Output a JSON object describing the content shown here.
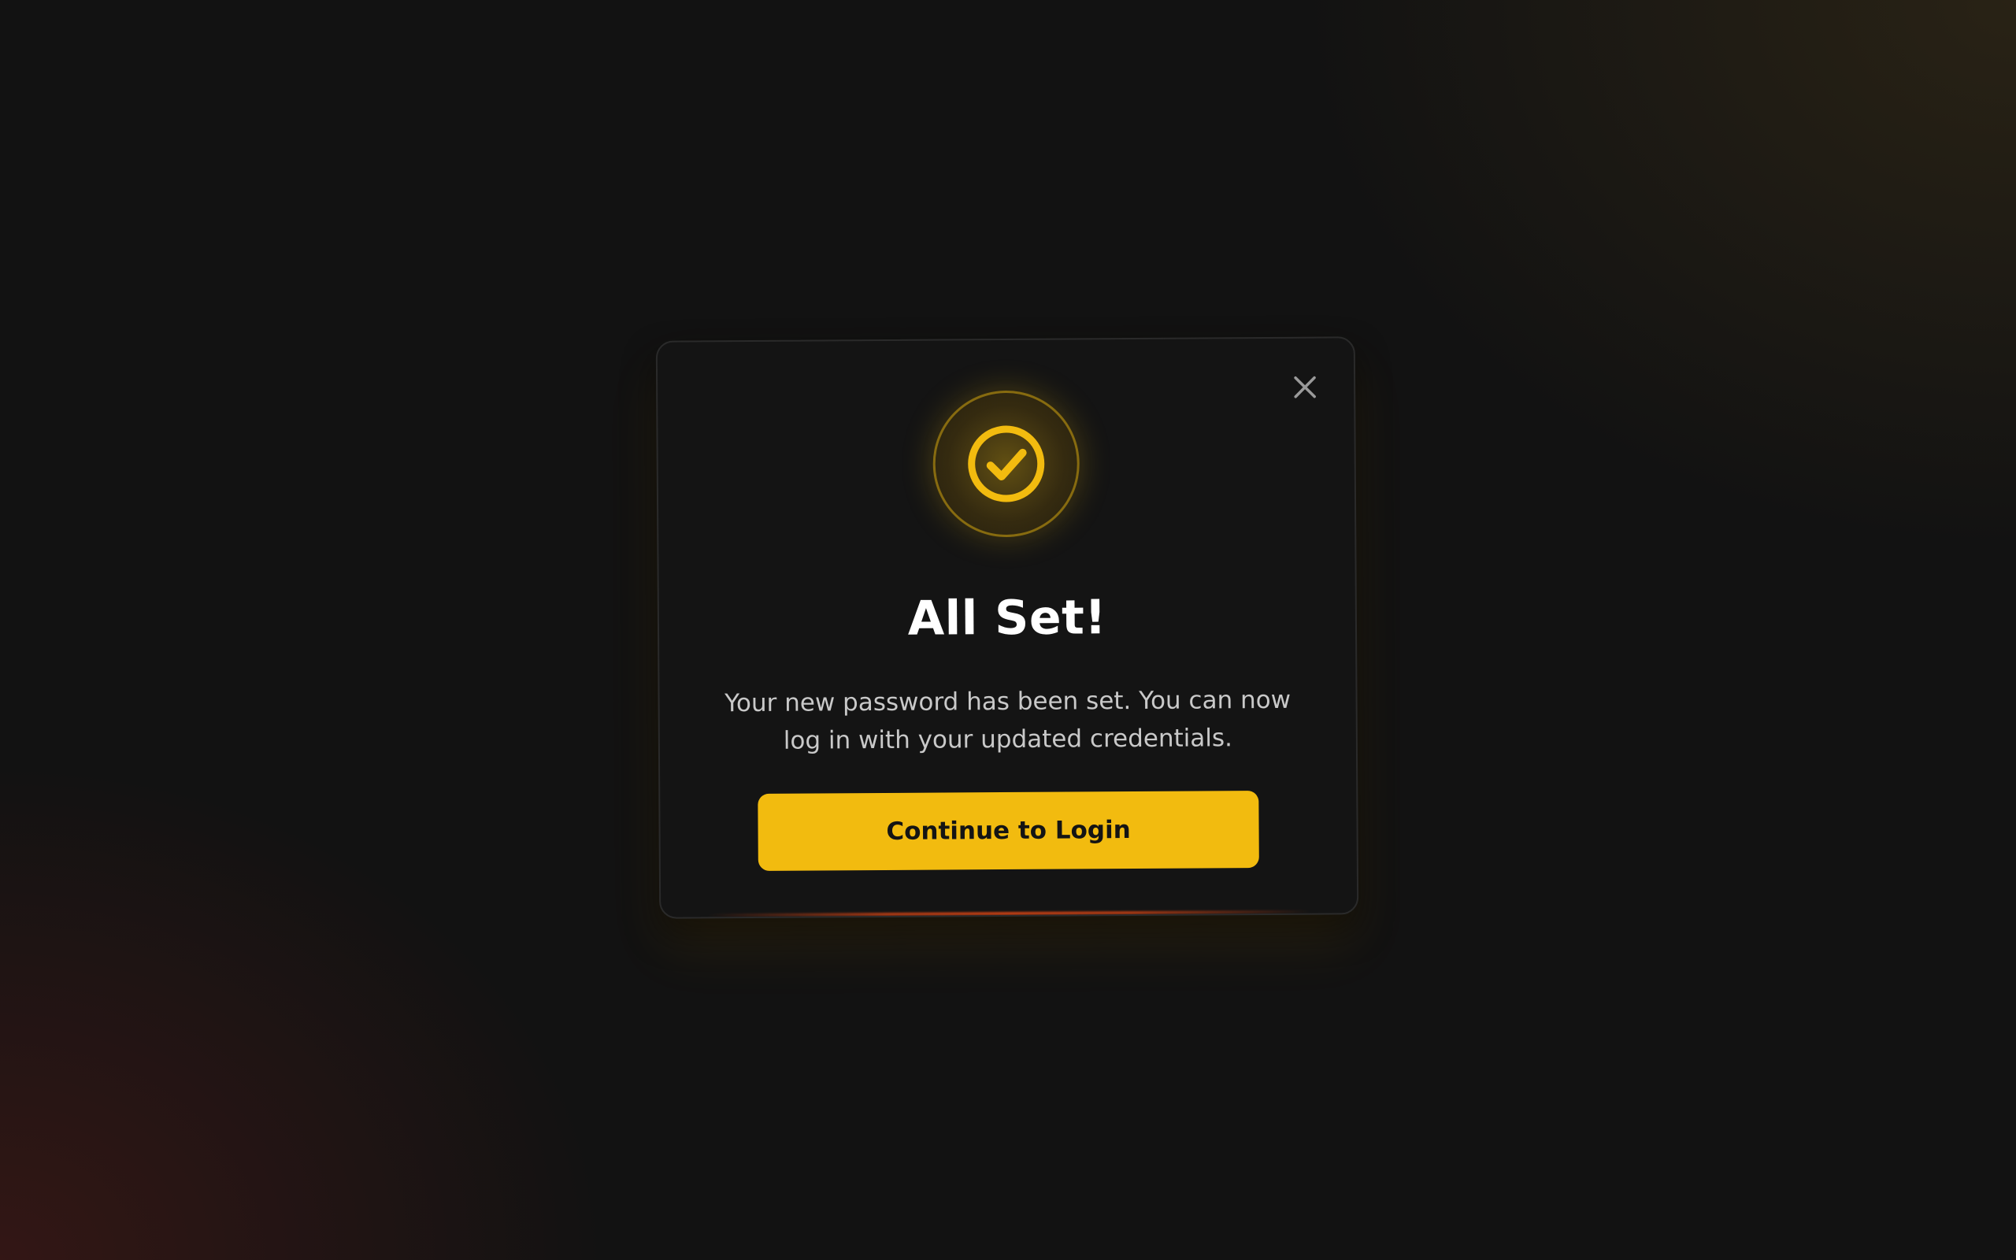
{
  "dialog": {
    "title": "All Set!",
    "message": "Your new password has been set. You can now log in with your updated credentials.",
    "primary_button_label": "Continue to Login",
    "close_icon": "close-icon",
    "status_icon": "check-circle-icon"
  },
  "colors": {
    "accent": "#f2bb0f",
    "background": "#121212",
    "card": "#141414",
    "title_text": "#ffffff",
    "body_text": "#c9c9c9",
    "button_text": "#141414",
    "close_icon": "#9a9a9a"
  }
}
